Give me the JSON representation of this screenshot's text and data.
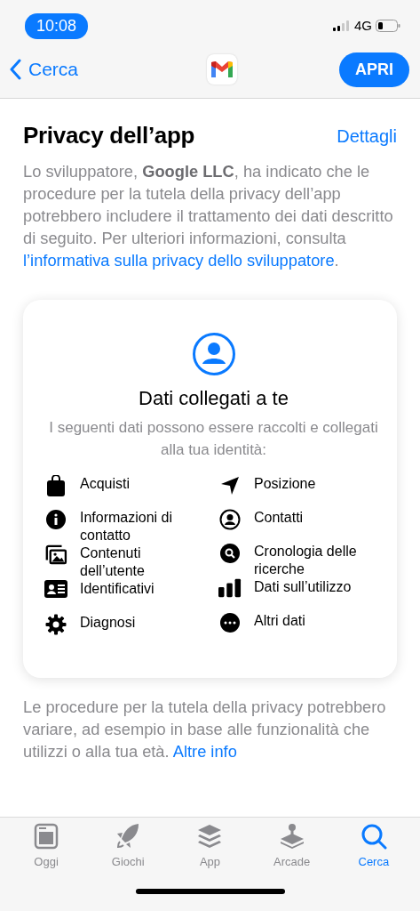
{
  "status_bar": {
    "time": "10:08",
    "network": "4G"
  },
  "nav": {
    "back_label": "Cerca",
    "open_button": "APRI"
  },
  "privacy": {
    "title": "Privacy dell’app",
    "details_link": "Dettagli",
    "intro": "Lo sviluppatore, **Google LLC**, ha indicato che le procedure per la tutela della privacy dell’app potrebbero includere il trattamento dei dati descritto di seguito. Per ulteriori informazioni, consulta ",
    "intro_link": "l’informativa sulla privacy dello sviluppatore",
    "intro_end": "."
  },
  "card": {
    "title": "Dati collegati a te",
    "subtitle": "I seguenti dati possono essere raccolti e collegati alla tua identità:",
    "left_items": [
      "Acquisti",
      "Informazioni di contatto",
      "Contenuti dell’utente",
      "Identificativi",
      "Diagnosi"
    ],
    "right_items": [
      "Posizione",
      "Contatti",
      "Cronologia delle ricerche",
      "Dati sull’utilizzo",
      "Altri dati"
    ]
  },
  "footer": {
    "text": "Le procedure per la tutela della privacy potrebbero variare, ad esempio in base alle funzionalità che utilizzi o alla tua età. ",
    "link": "Altre info"
  },
  "tabs": [
    {
      "label": "Oggi",
      "selected": false
    },
    {
      "label": "Giochi",
      "selected": false
    },
    {
      "label": "App",
      "selected": false
    },
    {
      "label": "Arcade",
      "selected": false
    },
    {
      "label": "Cerca",
      "selected": true
    }
  ]
}
